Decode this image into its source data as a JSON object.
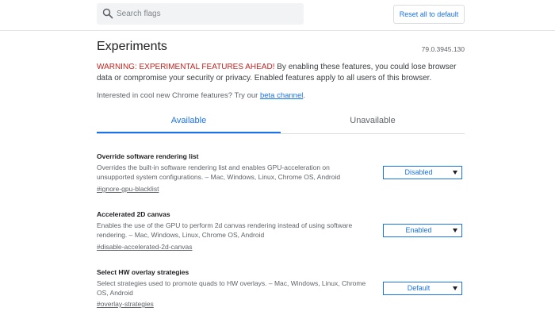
{
  "header": {
    "search_placeholder": "Search flags",
    "reset_label": "Reset all to default"
  },
  "page": {
    "title": "Experiments",
    "version": "79.0.3945.130",
    "warning_head": "WARNING: EXPERIMENTAL FEATURES AHEAD!",
    "warning_body": " By enabling these features, you could lose browser data or compromise your security or privacy. Enabled features apply to all users of this browser.",
    "interest_text": "Interested in cool new Chrome features? Try our ",
    "interest_link": "beta channel",
    "interest_end": "."
  },
  "tabs": {
    "available": "Available",
    "unavailable": "Unavailable"
  },
  "experiments": [
    {
      "name": "Override software rendering list",
      "description": "Overrides the built-in software rendering list and enables GPU-acceleration on unsupported system configurations. – Mac, Windows, Linux, Chrome OS, Android",
      "link": "#ignore-gpu-blacklist",
      "value": "Disabled"
    },
    {
      "name": "Accelerated 2D canvas",
      "description": "Enables the use of the GPU to perform 2d canvas rendering instead of using software rendering. – Mac, Windows, Linux, Chrome OS, Android",
      "link": "#disable-accelerated-2d-canvas",
      "value": "Enabled"
    },
    {
      "name": "Select HW overlay strategies",
      "description": "Select strategies used to promote quads to HW overlays. – Mac, Windows, Linux, Chrome OS, Android",
      "link": "#overlay-strategies",
      "value": "Default"
    }
  ],
  "colors": {
    "accent": "#1a73e8",
    "warning": "#c5221f",
    "search_bg": "#f1f3f4"
  }
}
